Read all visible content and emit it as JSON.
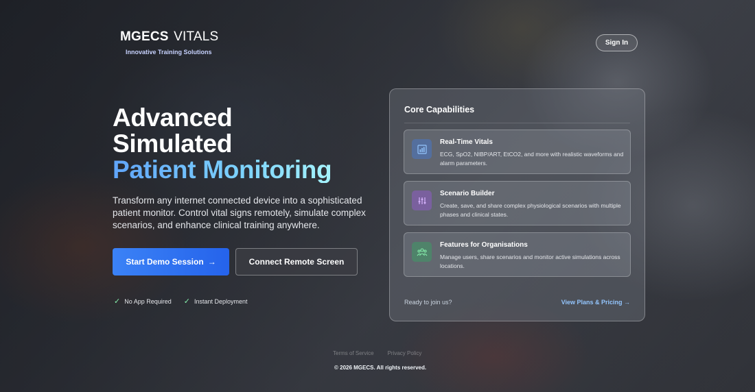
{
  "brand": {
    "name_bold": "MGECS",
    "name_light": "VITALS",
    "tagline": "Innovative Training Solutions"
  },
  "header": {
    "signin_label": "Sign In"
  },
  "hero": {
    "line1": "Advanced",
    "line2": "Simulated",
    "line3": "Patient Monitoring",
    "description": "Transform any internet connected device into a sophisticated patient monitor. Control vital signs remotely, simulate complex scenarios, and enhance clinical training anywhere.",
    "primary_button": "Start Demo Session",
    "primary_arrow": "→",
    "secondary_button": "Connect Remote Screen",
    "features": [
      "No App Required",
      "Instant Deployment"
    ]
  },
  "capabilities": {
    "title": "Core Capabilities",
    "cards": [
      {
        "icon": "bar-chart-icon",
        "title": "Real-Time Vitals",
        "description": "ECG, SpO2, NIBP/ART, EtCO2, and more with realistic waveforms and alarm parameters."
      },
      {
        "icon": "sliders-icon",
        "title": "Scenario Builder",
        "description": "Create, save, and share complex physiological scenarios with multiple phases and clinical states."
      },
      {
        "icon": "users-icon",
        "title": "Features for Organisations",
        "description": "Manage users, share scenarios and monitor active simulations across locations."
      }
    ],
    "footer_text": "Ready to join us?",
    "footer_link": "View Plans & Pricing →"
  },
  "footer": {
    "links": [
      "Terms of Service",
      "Privacy Policy"
    ],
    "copyright": "© 2026 MGECS. All rights reserved."
  },
  "colors": {
    "primary": "#3b82f6",
    "accent_gradient_start": "#60a5fa",
    "accent_gradient_end": "#a5f3fc",
    "check": "#86efac",
    "link": "#93c5fd"
  }
}
